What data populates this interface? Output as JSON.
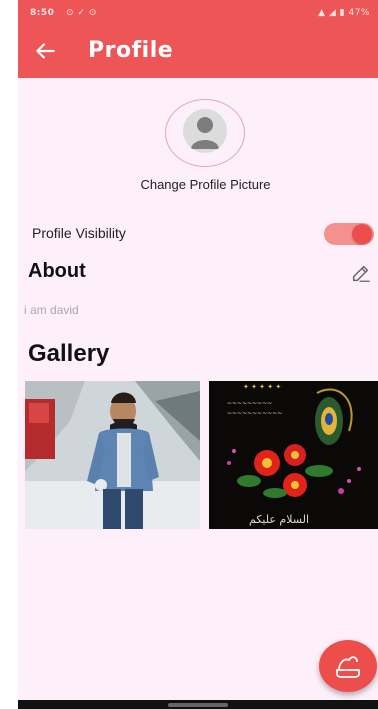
{
  "status_bar": {
    "time": "8:50",
    "left_icons": "⊙ ✓ ⊙",
    "battery": "47%"
  },
  "app_bar": {
    "title": "Profile",
    "back_icon": "arrow-left-icon"
  },
  "profile": {
    "change_picture_label": "Change Profile Picture",
    "visibility_label": "Profile Visibility",
    "visibility_on": true
  },
  "about": {
    "heading": "About",
    "text": "i am david",
    "edit_icon": "edit-icon"
  },
  "gallery": {
    "heading": "Gallery",
    "caption_text": "السلام علیکم"
  },
  "fab": {
    "icon": "add-photo-icon"
  },
  "colors": {
    "primary": "#ee5557",
    "background": "#fdf0fa"
  }
}
